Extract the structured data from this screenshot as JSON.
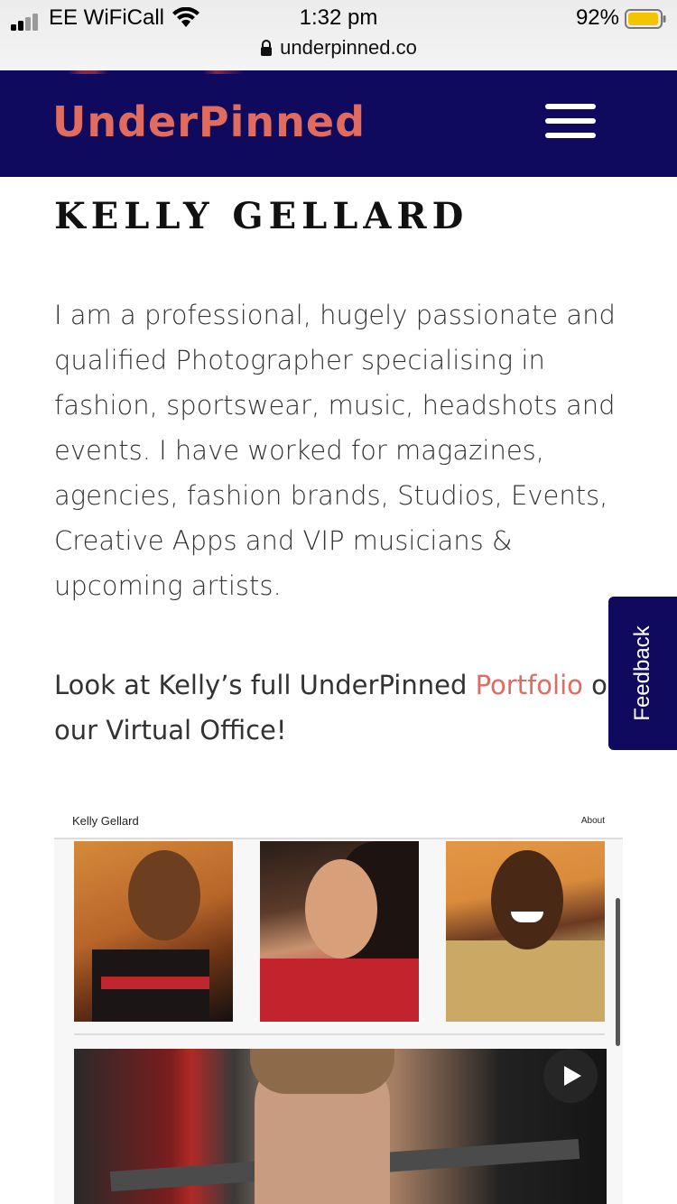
{
  "status_bar": {
    "carrier": "EE WiFiCall",
    "time": "1:32 pm",
    "battery": "92%",
    "url": "underpinned.co",
    "icons": [
      "signal-icon",
      "wifi-icon",
      "battery-icon",
      "lock-icon"
    ]
  },
  "header": {
    "logo": "UnderPinned",
    "menu_icon": "hamburger-menu-icon",
    "colors": {
      "background": "#0f0a5e",
      "logo": "#e06b5f"
    }
  },
  "profile": {
    "name": "KELLY GELLARD",
    "bio": "I am a professional, hugely passionate and qualified Photographer specialising in fashion, sportswear, music, headshots and events. I have worked for magazines, agencies, fashion brands, Studios, Events, Creative Apps and VIP musicians & upcoming artists.",
    "look_prefix": "Look at Kelly’s full UnderPinned ",
    "portfolio_link": "Portfolio",
    "look_suffix": " on our Virtual Office!"
  },
  "feedback": {
    "label": "Feedback"
  },
  "preview": {
    "site_name": "Kelly Gellard",
    "about_link": "About",
    "play_icon": "play-icon"
  }
}
